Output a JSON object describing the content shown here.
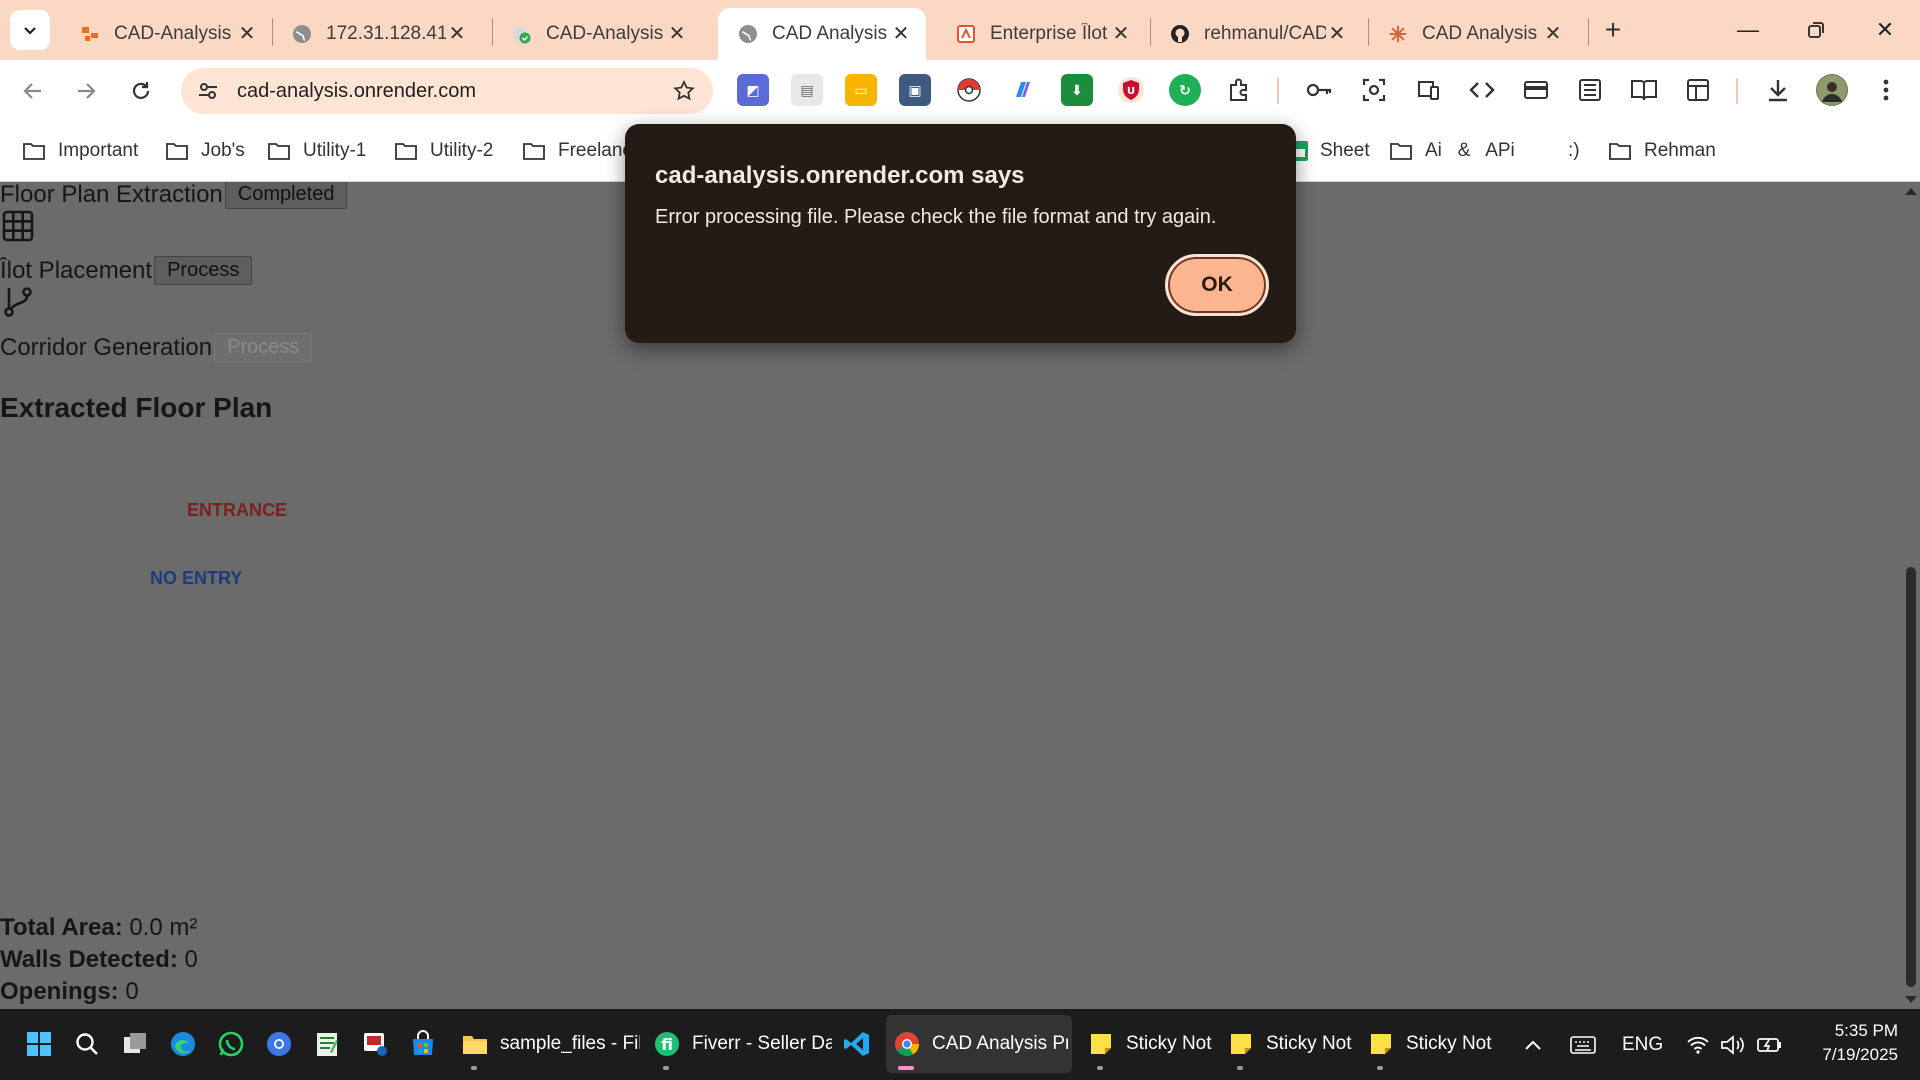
{
  "browser": {
    "tabs": [
      {
        "title": "CAD-Analysis",
        "favicon": "orange-blocks-icon",
        "active": false
      },
      {
        "title": "172.31.128.41",
        "favicon": "globe-icon",
        "active": false
      },
      {
        "title": "CAD-Analysis",
        "favicon": "check-shield-icon",
        "active": false
      },
      {
        "title": "CAD Analysis",
        "favicon": "globe-icon",
        "active": true
      },
      {
        "title": "Enterprise Îlot",
        "favicon": "orange-doc-icon",
        "active": false
      },
      {
        "title": "rehmanul/CAD",
        "favicon": "github-icon",
        "active": false
      },
      {
        "title": "CAD Analysis",
        "favicon": "claude-icon",
        "active": false
      }
    ],
    "url": "cad-analysis.onrender.com",
    "bookmarks": [
      {
        "label": "Important",
        "type": "folder"
      },
      {
        "label": "Job's",
        "type": "folder"
      },
      {
        "label": "Utility-1",
        "type": "folder"
      },
      {
        "label": "Utility-2",
        "type": "folder"
      },
      {
        "label": "Freelanc",
        "type": "folder"
      },
      {
        "label": "Sheet",
        "type": "sheet"
      },
      {
        "label": "Ai   &   APi",
        "type": "folder"
      },
      {
        "label": ":)",
        "type": "text"
      },
      {
        "label": "Rehman",
        "type": "folder"
      }
    ],
    "accent_color": "#fbd8c3"
  },
  "page": {
    "steps": [
      {
        "label": "Floor Plan Extraction",
        "button": "Completed",
        "button_disabled": false
      },
      {
        "label": "Îlot Placement",
        "button": "Process",
        "button_disabled": false
      },
      {
        "label": "Corridor Generation",
        "button": "Process",
        "button_disabled": true
      }
    ],
    "section_heading": "Extracted Floor Plan",
    "plan_labels": {
      "entrance": "ENTRANCE",
      "no_entry": "NO ENTRY"
    },
    "stats": [
      {
        "label": "Total Area:",
        "value": "0.0 m²"
      },
      {
        "label": "Walls Detected:",
        "value": "0"
      },
      {
        "label": "Openings:",
        "value": "0"
      }
    ]
  },
  "alert": {
    "title": "cad-analysis.onrender.com says",
    "message": "Error processing file. Please check the file format and try again.",
    "ok_label": "OK"
  },
  "taskbar": {
    "apps": [
      {
        "label": "sample_files - Fil",
        "icon": "folder-icon"
      },
      {
        "label": "Fiverr - Seller Da",
        "icon": "fiverr-icon"
      },
      {
        "label": "CAD Analysis Prc",
        "icon": "chrome-icon",
        "active": true
      },
      {
        "label": "Sticky Not",
        "icon": "sticky-notes-icon"
      },
      {
        "label": "Sticky Not",
        "icon": "sticky-notes-icon"
      },
      {
        "label": "Sticky Not",
        "icon": "sticky-notes-icon"
      }
    ],
    "language": "ENG",
    "time": "5:35 PM",
    "date": "7/19/2025"
  }
}
